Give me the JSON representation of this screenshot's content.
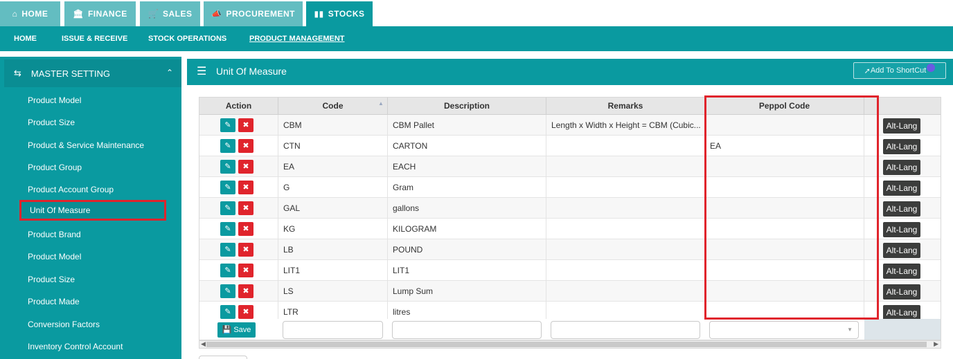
{
  "topnav": {
    "tabs": [
      {
        "label": "HOME",
        "icon": "home-icon"
      },
      {
        "label": "FINANCE",
        "icon": "bank-icon"
      },
      {
        "label": "SALES",
        "icon": "cart-icon"
      },
      {
        "label": "PROCUREMENT",
        "icon": "bullhorn-icon"
      },
      {
        "label": "STOCKS",
        "icon": "bar-chart-icon"
      }
    ],
    "active": "STOCKS"
  },
  "subnav": {
    "items": [
      "HOME",
      "ISSUE & RECEIVE",
      "STOCK OPERATIONS",
      "PRODUCT MANAGEMENT"
    ],
    "active": "PRODUCT MANAGEMENT"
  },
  "sidebar": {
    "header": "MASTER SETTING",
    "items": [
      "Product Model",
      "Product Size",
      "Product & Service Maintenance",
      "Product Group",
      "Product Account Group",
      "Unit Of Measure",
      "Product Brand",
      "Product Model",
      "Product Size",
      "Product Made",
      "Conversion Factors",
      "Inventory Control Account"
    ],
    "active": "Unit Of Measure"
  },
  "panel": {
    "title": "Unit Of Measure",
    "shortcut_label": "Add To ShortCut"
  },
  "grid": {
    "columns": [
      "Action",
      "Code",
      "Description",
      "Remarks",
      "Peppol Code"
    ],
    "rows": [
      {
        "code": "CBM",
        "description": "CBM Pallet",
        "remarks": "Length x Width x Height = CBM (Cubic...",
        "peppol": "",
        "alt": "Alt-Lang"
      },
      {
        "code": "CTN",
        "description": "CARTON",
        "remarks": "",
        "peppol": "EA",
        "alt": "Alt-Lang"
      },
      {
        "code": "EA",
        "description": "EACH",
        "remarks": "",
        "peppol": "",
        "alt": "Alt-Lang"
      },
      {
        "code": "G",
        "description": "Gram",
        "remarks": "",
        "peppol": "",
        "alt": "Alt-Lang"
      },
      {
        "code": "GAL",
        "description": "gallons",
        "remarks": "",
        "peppol": "",
        "alt": "Alt-Lang"
      },
      {
        "code": "KG",
        "description": "KILOGRAM",
        "remarks": "",
        "peppol": "",
        "alt": "Alt-Lang"
      },
      {
        "code": "LB",
        "description": "POUND",
        "remarks": "",
        "peppol": "",
        "alt": "Alt-Lang"
      },
      {
        "code": "LIT1",
        "description": "LIT1",
        "remarks": "",
        "peppol": "",
        "alt": "Alt-Lang"
      },
      {
        "code": "LS",
        "description": "Lump Sum",
        "remarks": "",
        "peppol": "",
        "alt": "Alt-Lang"
      },
      {
        "code": "LTR",
        "description": "litres",
        "remarks": "",
        "peppol": "",
        "alt": "Alt-Lang"
      }
    ],
    "save_label": "Save"
  },
  "colors": {
    "teal": "#0a9aa0",
    "teal_light": "#63bdc1",
    "delete_red": "#e0242c",
    "highlight_red": "#e0242c",
    "alt_button": "#3c3d3c"
  }
}
